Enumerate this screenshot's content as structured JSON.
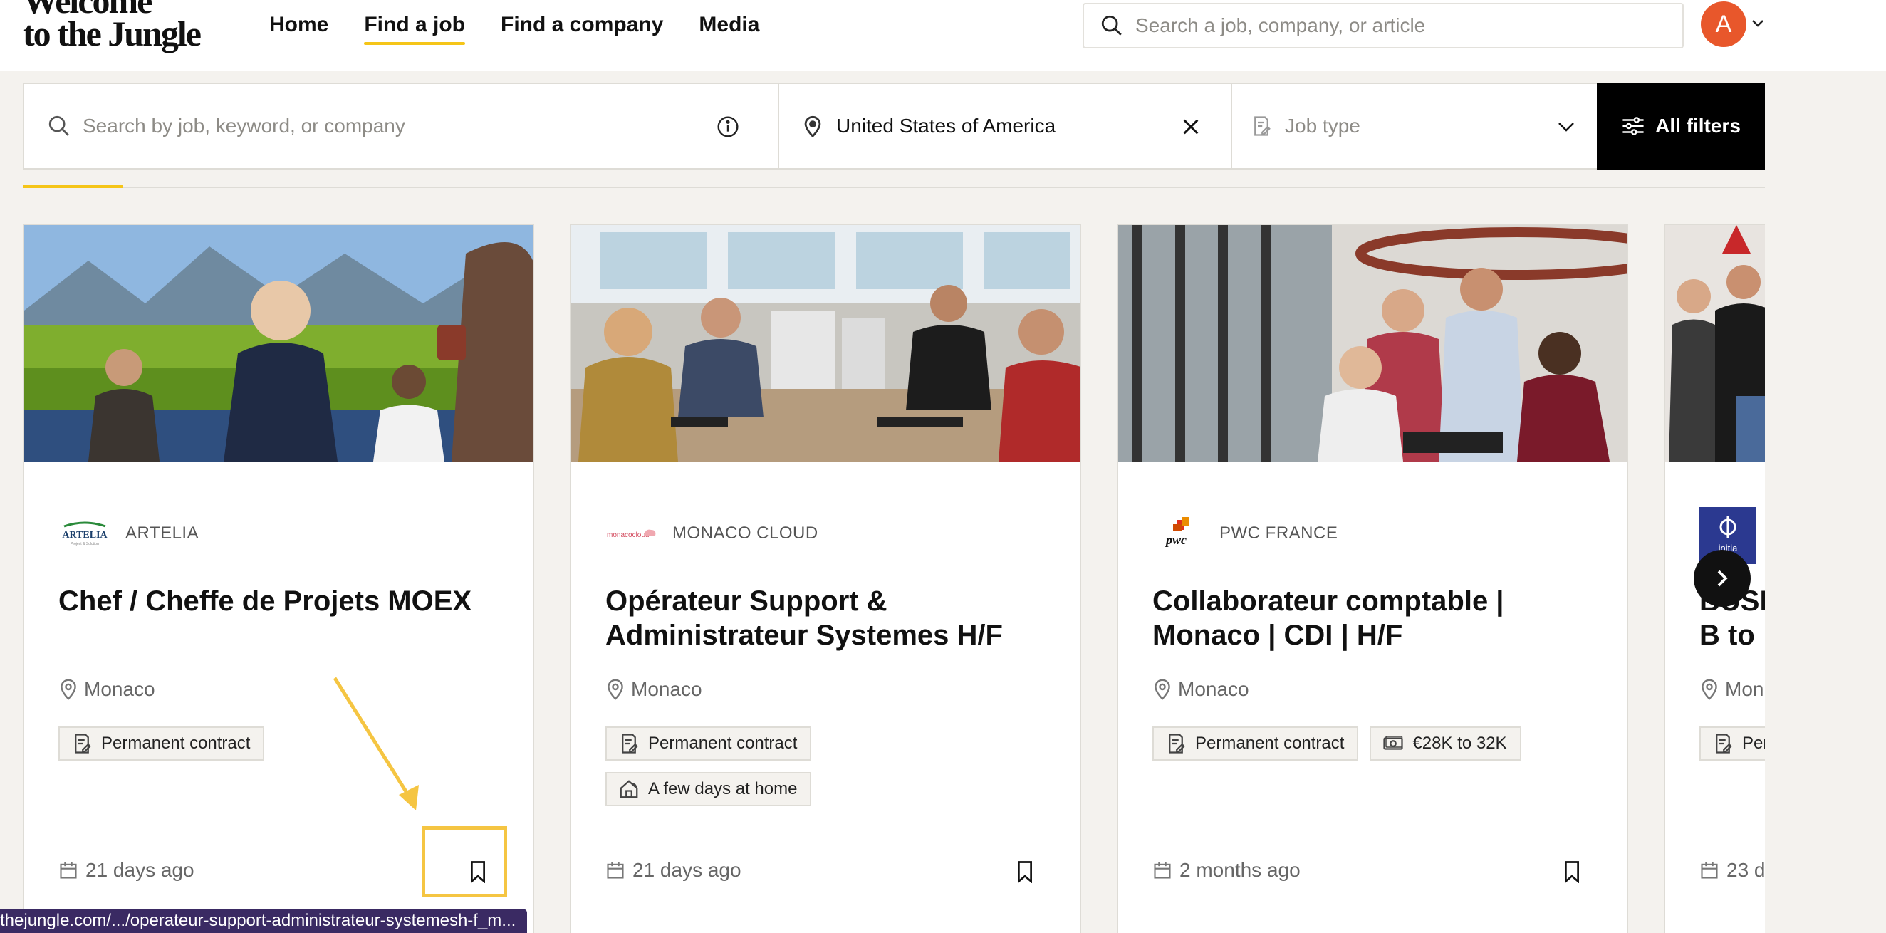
{
  "header": {
    "logo_line1": "Welcome",
    "logo_line2": "to the Jungle",
    "nav": [
      {
        "label": "Home",
        "active": false
      },
      {
        "label": "Find a job",
        "active": true
      },
      {
        "label": "Find a company",
        "active": false
      },
      {
        "label": "Media",
        "active": false
      }
    ],
    "search_placeholder": "Search a job, company, or article",
    "avatar_initial": "A"
  },
  "filters": {
    "keyword_placeholder": "Search by job, keyword, or company",
    "location_value": "United States of America",
    "job_type_placeholder": "Job type",
    "all_filters_label": "All filters"
  },
  "cards": [
    {
      "company": "ARTELIA",
      "title": "Chef / Cheffe de Projets MOEX",
      "location": "Monaco",
      "tags": [
        {
          "icon": "contract-icon",
          "label": "Permanent contract"
        }
      ],
      "posted": "21 days ago"
    },
    {
      "company": "MONACO CLOUD",
      "title": "Opérateur Support & Administrateur Systemes H/F",
      "location": "Monaco",
      "tags": [
        {
          "icon": "contract-icon",
          "label": "Permanent contract"
        },
        {
          "icon": "remote-home-icon",
          "label": "A few days at home"
        }
      ],
      "posted": "21 days ago"
    },
    {
      "company": "PWC FRANCE",
      "title": "Collaborateur comptable | Monaco | CDI | H/F",
      "location": "Monaco",
      "tags": [
        {
          "icon": "contract-icon",
          "label": "Permanent contract"
        },
        {
          "icon": "salary-icon",
          "label": "€28K to 32K"
        }
      ],
      "posted": "2 months ago"
    },
    {
      "company": "",
      "title": "BUSI B to",
      "location": "Mon",
      "tags": [
        {
          "icon": "contract-icon",
          "label": "Per"
        }
      ],
      "posted": "23 d"
    }
  ],
  "logos": {
    "artelia": "ARTELIA",
    "monaco_cloud": "monacocloud",
    "pwc": "pwc",
    "initia": "initia"
  },
  "status_url": "thejungle.com/.../operateur-support-administrateur-systemesh-f_m...",
  "colors": {
    "accent_yellow": "#f5c518",
    "avatar": "#e8572b",
    "status_bar": "#3a2a63"
  }
}
